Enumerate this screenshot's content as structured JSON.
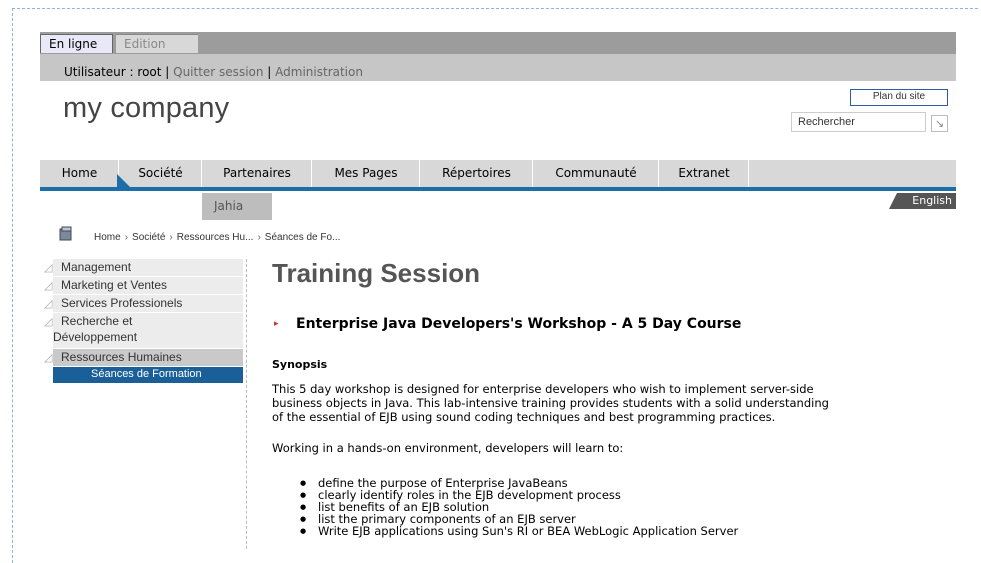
{
  "mode_tabs": {
    "active": "En ligne",
    "inactive": "Edition"
  },
  "user_bar": {
    "prefix": "Utilisateur : root",
    "sep": " | ",
    "logout": "Quitter session",
    "admin": "Administration"
  },
  "logo": "my company",
  "sitemap": "Plan du site",
  "search": {
    "value": "Rechercher",
    "button_icon": "arrow-icon"
  },
  "nav": [
    "Home",
    "Société",
    "Partenaires",
    "Mes Pages",
    "Répertoires",
    "Communauté",
    "Extranet"
  ],
  "subnav": "Jahia",
  "language": "English",
  "breadcrumb": [
    "Home",
    "Société",
    "Ressources Hu...",
    "Séances de Fo..."
  ],
  "sidebar": {
    "items": [
      "Management",
      "Marketing et Ventes",
      "Services Professionels",
      "Recherche et",
      "Développement",
      "Ressources Humaines"
    ],
    "sub": "Séances de Formation"
  },
  "content": {
    "title": "Training Session",
    "course": "Enterprise Java Developers's Workshop - A 5 Day Course",
    "synopsis": "Synopsis",
    "paragraph1_l1": "This 5 day workshop is designed for enterprise developers who wish to implement server-side",
    "paragraph1_l2": "business objects in Java. This lab-intensive training provides students with a solid understanding",
    "paragraph1_l3": "of the essential of EJB using sound coding techniques and best programming practices.",
    "paragraph2": "Working in a hands-on environment, developers will learn to:",
    "bullets": [
      "define the purpose of Enterprise JavaBeans",
      "clearly identify roles in the EJB development process",
      "list benefits of an EJB solution",
      "list the primary components of an EJB server",
      "Write EJB applications using Sun's RI or BEA WebLogic Application Server"
    ]
  },
  "colors": {
    "nav_blue": "#1b6eaa",
    "sidebar_selected": "#1b5f99"
  }
}
